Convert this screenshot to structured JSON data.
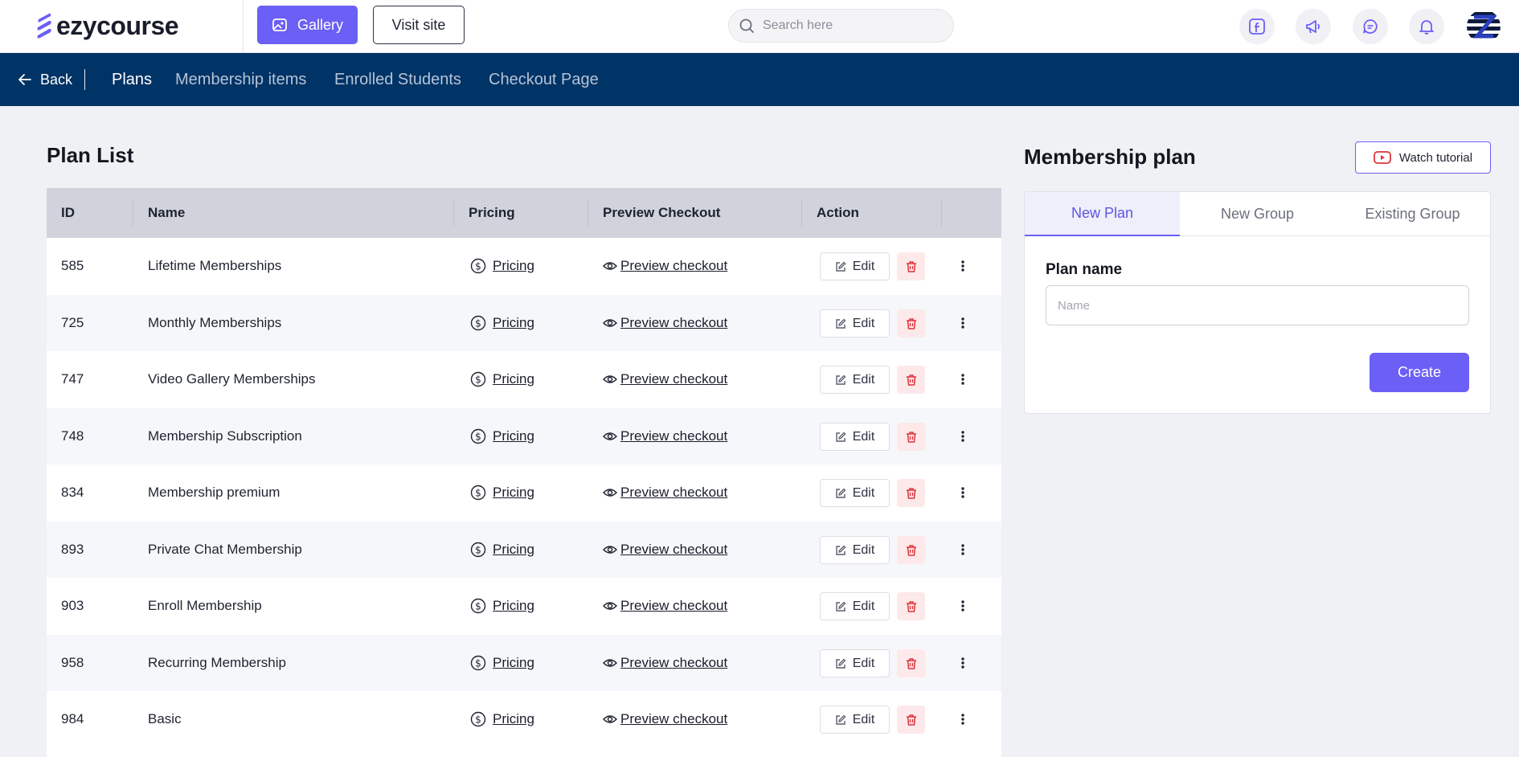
{
  "header": {
    "logo_text": "ezycourse",
    "gallery_label": "Gallery",
    "visit_site_label": "Visit site",
    "search_placeholder": "Search here",
    "icons": [
      "facebook-icon",
      "megaphone-icon",
      "chat-icon",
      "bell-icon"
    ],
    "accent_color": "#6b5ff5"
  },
  "nav": {
    "back_label": "Back",
    "tabs": [
      {
        "label": "Plans",
        "active": true
      },
      {
        "label": "Membership items",
        "active": false
      },
      {
        "label": "Enrolled Students",
        "active": false
      },
      {
        "label": "Checkout Page",
        "active": false
      }
    ],
    "bar_color": "#003366"
  },
  "plan_list": {
    "title": "Plan List",
    "columns": [
      "ID",
      "Name",
      "Pricing",
      "Preview Checkout",
      "Action"
    ],
    "pricing_label": "Pricing",
    "preview_label": "Preview checkout",
    "edit_label": "Edit",
    "rows": [
      {
        "id": "585",
        "name": "Lifetime Memberships"
      },
      {
        "id": "725",
        "name": "Monthly Memberships"
      },
      {
        "id": "747",
        "name": "Video Gallery Memberships"
      },
      {
        "id": "748",
        "name": "Membership Subscription"
      },
      {
        "id": "834",
        "name": "Membership premium"
      },
      {
        "id": "893",
        "name": "Private Chat Membership"
      },
      {
        "id": "903",
        "name": "Enroll Membership"
      },
      {
        "id": "958",
        "name": "Recurring Membership"
      },
      {
        "id": "984",
        "name": "Basic"
      }
    ]
  },
  "membership_plan": {
    "title": "Membership plan",
    "watch_tutorial_label": "Watch tutorial",
    "tabs": [
      {
        "label": "New Plan",
        "active": true
      },
      {
        "label": "New Group",
        "active": false
      },
      {
        "label": "Existing Group",
        "active": false
      }
    ],
    "field_label": "Plan name",
    "field_placeholder": "Name",
    "field_value": "",
    "create_label": "Create"
  }
}
